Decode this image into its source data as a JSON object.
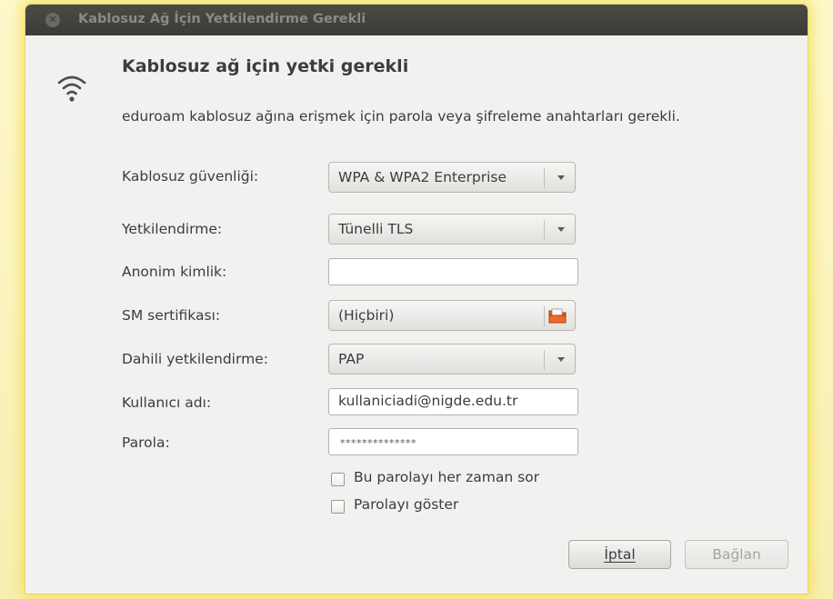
{
  "window": {
    "title": "Kablosuz Ağ İçin Yetkilendirme Gerekli"
  },
  "dialog": {
    "heading": "Kablosuz ağ için yetki gerekli",
    "description": "eduroam kablosuz ağına erişmek için parola veya şifreleme anahtarları gerekli."
  },
  "form": {
    "security": {
      "label": "Kablosuz güvenliği:",
      "value": "WPA & WPA2 Enterprise"
    },
    "authentication": {
      "label": "Yetkilendirme:",
      "value": "Tünelli TLS"
    },
    "anonymous_identity": {
      "label": "Anonim kimlik:",
      "value": ""
    },
    "ca_certificate": {
      "label": "SM sertifikası:",
      "value": "(Hiçbiri)"
    },
    "inner_auth": {
      "label": "Dahili yetkilendirme:",
      "value": "PAP"
    },
    "username": {
      "label": "Kullanıcı adı:",
      "value": "kullaniciadi@nigde.edu.tr"
    },
    "password": {
      "label": "Parola:",
      "value": "**************"
    },
    "ask_always": {
      "label": "Bu parolayı her zaman sor",
      "checked": false
    },
    "show_password": {
      "label": "Parolayı göster",
      "checked": false
    }
  },
  "buttons": {
    "cancel": "İptal",
    "connect": "Bağlan"
  },
  "colors": {
    "titlebar": "#3c3b37",
    "window_bg": "#f2f1f0",
    "highlight_glow": "#f4df5e",
    "folder": "#e0561a"
  },
  "icons": {
    "window_close": "close-icon",
    "network": "wifi-icon",
    "dropdown": "chevron-down-icon",
    "file_chooser": "folder-icon"
  }
}
